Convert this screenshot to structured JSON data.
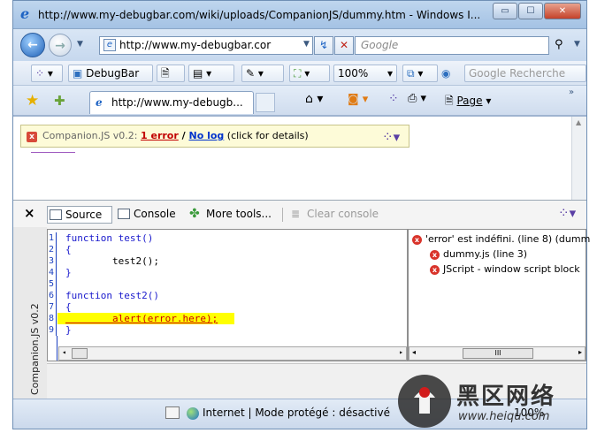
{
  "window": {
    "title": "http://www.my-debugbar.com/wiki/uploads/CompanionJS/dummy.htm - Windows I...",
    "min_label": "▭",
    "max_label": "☐",
    "close_label": "✕"
  },
  "address": {
    "url": "http://www.my-debugbar.cor",
    "search_placeholder": "Google",
    "refresh_label": "↯",
    "stop_label": "✕"
  },
  "toolbar1": {
    "debugbar_label": "DebugBar",
    "zoom_value": "100%",
    "google_search": "Google Recherche"
  },
  "toolbar2": {
    "tab_label": "http://www.my-debugb...",
    "page_menu": "Page"
  },
  "companion_bar": {
    "prefix": "Companion.JS v0.2: ",
    "error_link": "1 error",
    "sep": " / ",
    "log_link": "No log",
    "suffix": " (click for details)"
  },
  "panel": {
    "close": "×",
    "tabs": [
      {
        "label": "Source"
      },
      {
        "label": "Console"
      },
      {
        "label": "More tools..."
      },
      {
        "label": "Clear console"
      }
    ],
    "side_label": "Companion.JS v0.2",
    "code_lines": [
      {
        "num": "1",
        "text": "function test()"
      },
      {
        "num": "2",
        "text": "{"
      },
      {
        "num": "3",
        "text": "        test2();"
      },
      {
        "num": "4",
        "text": "}"
      },
      {
        "num": "5",
        "text": ""
      },
      {
        "num": "6",
        "text": "function test2()"
      },
      {
        "num": "7",
        "text": "{"
      },
      {
        "num": "8",
        "text": "        alert(error.here);"
      },
      {
        "num": "9",
        "text": "}"
      }
    ],
    "errors": [
      {
        "text": "'error' est indéfini. (line 8) (dumm"
      },
      {
        "text": "dummy.js (line 3)"
      },
      {
        "text": "JScript - window script block"
      }
    ],
    "scroll_mid": "III"
  },
  "status": {
    "zone": "Internet | Mode protégé : désactivé",
    "zoom": "100%"
  },
  "watermark": {
    "cn": "黑区网络",
    "url": "www.heiqu.com"
  }
}
